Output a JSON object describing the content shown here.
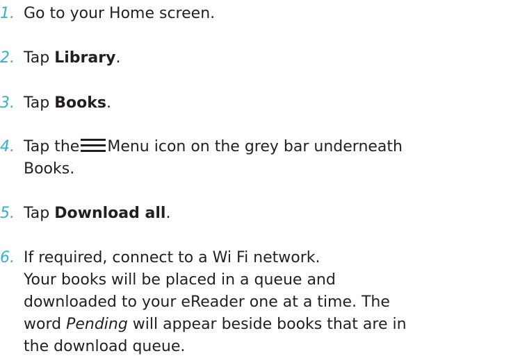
{
  "steps": [
    {
      "number": "1.",
      "text": "Go to your Home screen."
    },
    {
      "number": "2.",
      "prefix": "Tap ",
      "bold": "Library",
      "suffix": "."
    },
    {
      "number": "3.",
      "prefix": "Tap ",
      "bold": "Books",
      "suffix": "."
    },
    {
      "number": "4.",
      "prefix": "Tap the",
      "icon": "menu-icon",
      "suffix_line1": "Menu icon on the grey bar underneath",
      "suffix_line2": "Books."
    },
    {
      "number": "5.",
      "prefix": "Tap ",
      "bold": "Download all",
      "suffix": "."
    },
    {
      "number": "6.",
      "line1": "If required, connect to a Wi Fi network.",
      "line2": "Your books will be placed in a queue and",
      "line3": "downloaded to your eReader one at a time. The",
      "line4_prefix": "word ",
      "line4_italic": "Pending",
      "line4_suffix": " will appear beside books that are in",
      "line5": "the download queue."
    }
  ],
  "colors": {
    "number": "#34b2c6",
    "text": "#231f20"
  }
}
